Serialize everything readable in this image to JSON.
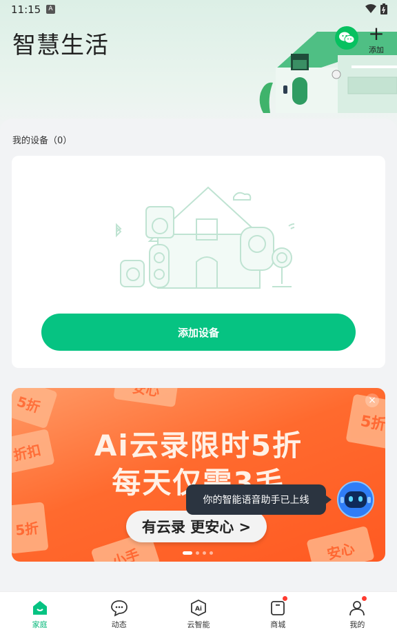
{
  "status_bar": {
    "time": "11:15",
    "notification_letter": "A"
  },
  "header": {
    "title": "智慧生活",
    "add_label": "添加"
  },
  "devices": {
    "section_label": "我的设备（0）",
    "add_button": "添加设备"
  },
  "banner": {
    "line1": "Ai云录限时5折",
    "line2": "每天仅需3毛",
    "cta": "有云录 更安心 >",
    "close": "×",
    "coupon_texts": [
      "5折",
      "折扣",
      "安心",
      "5折",
      "5折",
      "安心",
      "小手"
    ],
    "slides": 4,
    "active_slide": 1
  },
  "assistant": {
    "tooltip": "你的智能语音助手已上线"
  },
  "tabbar": {
    "items": [
      {
        "label": "家庭",
        "icon": "home-icon",
        "active": true,
        "badge": false
      },
      {
        "label": "动态",
        "icon": "message-icon",
        "active": false,
        "badge": false
      },
      {
        "label": "云智能",
        "icon": "ai-icon",
        "active": false,
        "badge": false
      },
      {
        "label": "商城",
        "icon": "shop-icon",
        "active": false,
        "badge": true
      },
      {
        "label": "我的",
        "icon": "profile-icon",
        "active": false,
        "badge": true
      }
    ]
  },
  "colors": {
    "accent": "#06c382",
    "banner": "#ff6a2e",
    "badge": "#ff3b30",
    "wechat": "#07c160"
  }
}
